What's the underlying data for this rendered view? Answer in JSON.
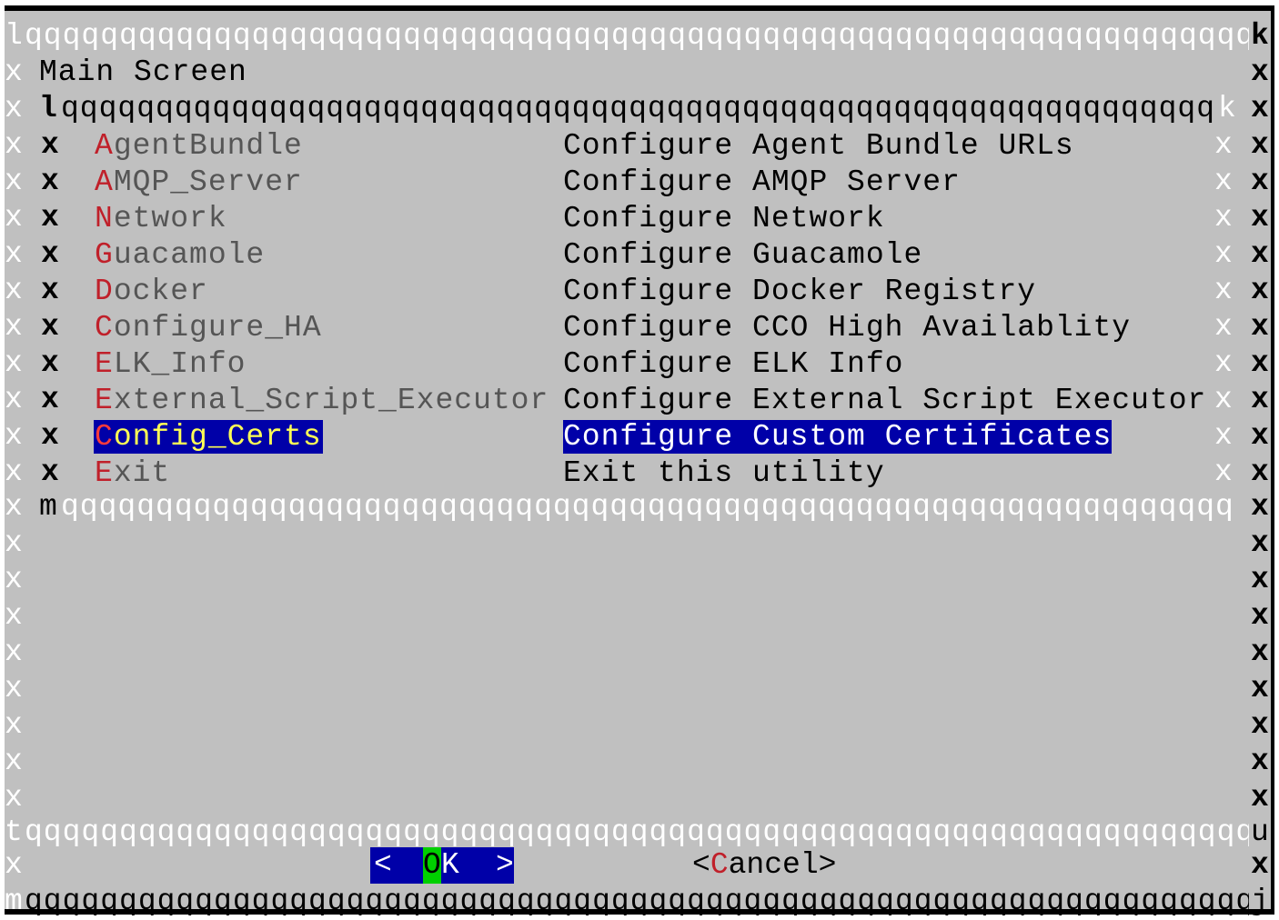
{
  "box_chars": {
    "corner_tl": "l",
    "corner_tr": "k",
    "corner_bl": "m",
    "corner_br": "j",
    "tee_left": "t",
    "tee_right": "u",
    "vertical": "x",
    "outer_top_fill": "qqqqqqqqqqqqqqqqqqqqqqqqqqqqqqqqqqqqqqqqqqqqqqqqqqqqqqqqqqqqqqqqqqqqqqqqqqqqqqqqqqqq",
    "inner_fill": "qqqqqqqqqqqqqqqqqqqqqqqqqqqqqqqqqqqqqqqqqqqqqqqqqqqqqqqqqqqqqqqqqqqqqqqqqqqqqqqq"
  },
  "dialog": {
    "title": "Main Screen",
    "menu": [
      {
        "hotkey": "A",
        "rest": "gentBundle",
        "description": "Configure Agent Bundle URLs"
      },
      {
        "hotkey": "A",
        "rest": "MQP_Server",
        "description": "Configure AMQP Server"
      },
      {
        "hotkey": "N",
        "rest": "etwork",
        "description": "Configure Network"
      },
      {
        "hotkey": "G",
        "rest": "uacamole",
        "description": "Configure Guacamole"
      },
      {
        "hotkey": "D",
        "rest": "ocker",
        "description": "Configure Docker Registry"
      },
      {
        "hotkey": "C",
        "rest": "onfigure_HA",
        "description": "Configure CCO High Availablity"
      },
      {
        "hotkey": "E",
        "rest": "LK_Info",
        "description": "Configure ELK Info"
      },
      {
        "hotkey": "E",
        "rest": "xternal_Script_Executor",
        "description": "Configure External Script Executor"
      },
      {
        "hotkey": "C",
        "rest": "onfig_Certs",
        "description": "Configure Custom Certificates",
        "selected": true
      },
      {
        "hotkey": "E",
        "rest": "xit",
        "description": "Exit this utility"
      }
    ],
    "buttons": {
      "ok": {
        "left": "<",
        "cursor": "O",
        "rest": "K",
        "right": ">"
      },
      "cancel": {
        "open": "<",
        "hotkey": "C",
        "rest": "ancel",
        "close": ">"
      }
    }
  },
  "colors": {
    "background": "#c0c0c0",
    "selection": "#0000a8",
    "hotkey": "#c0202a",
    "cursor": "#00d000"
  }
}
